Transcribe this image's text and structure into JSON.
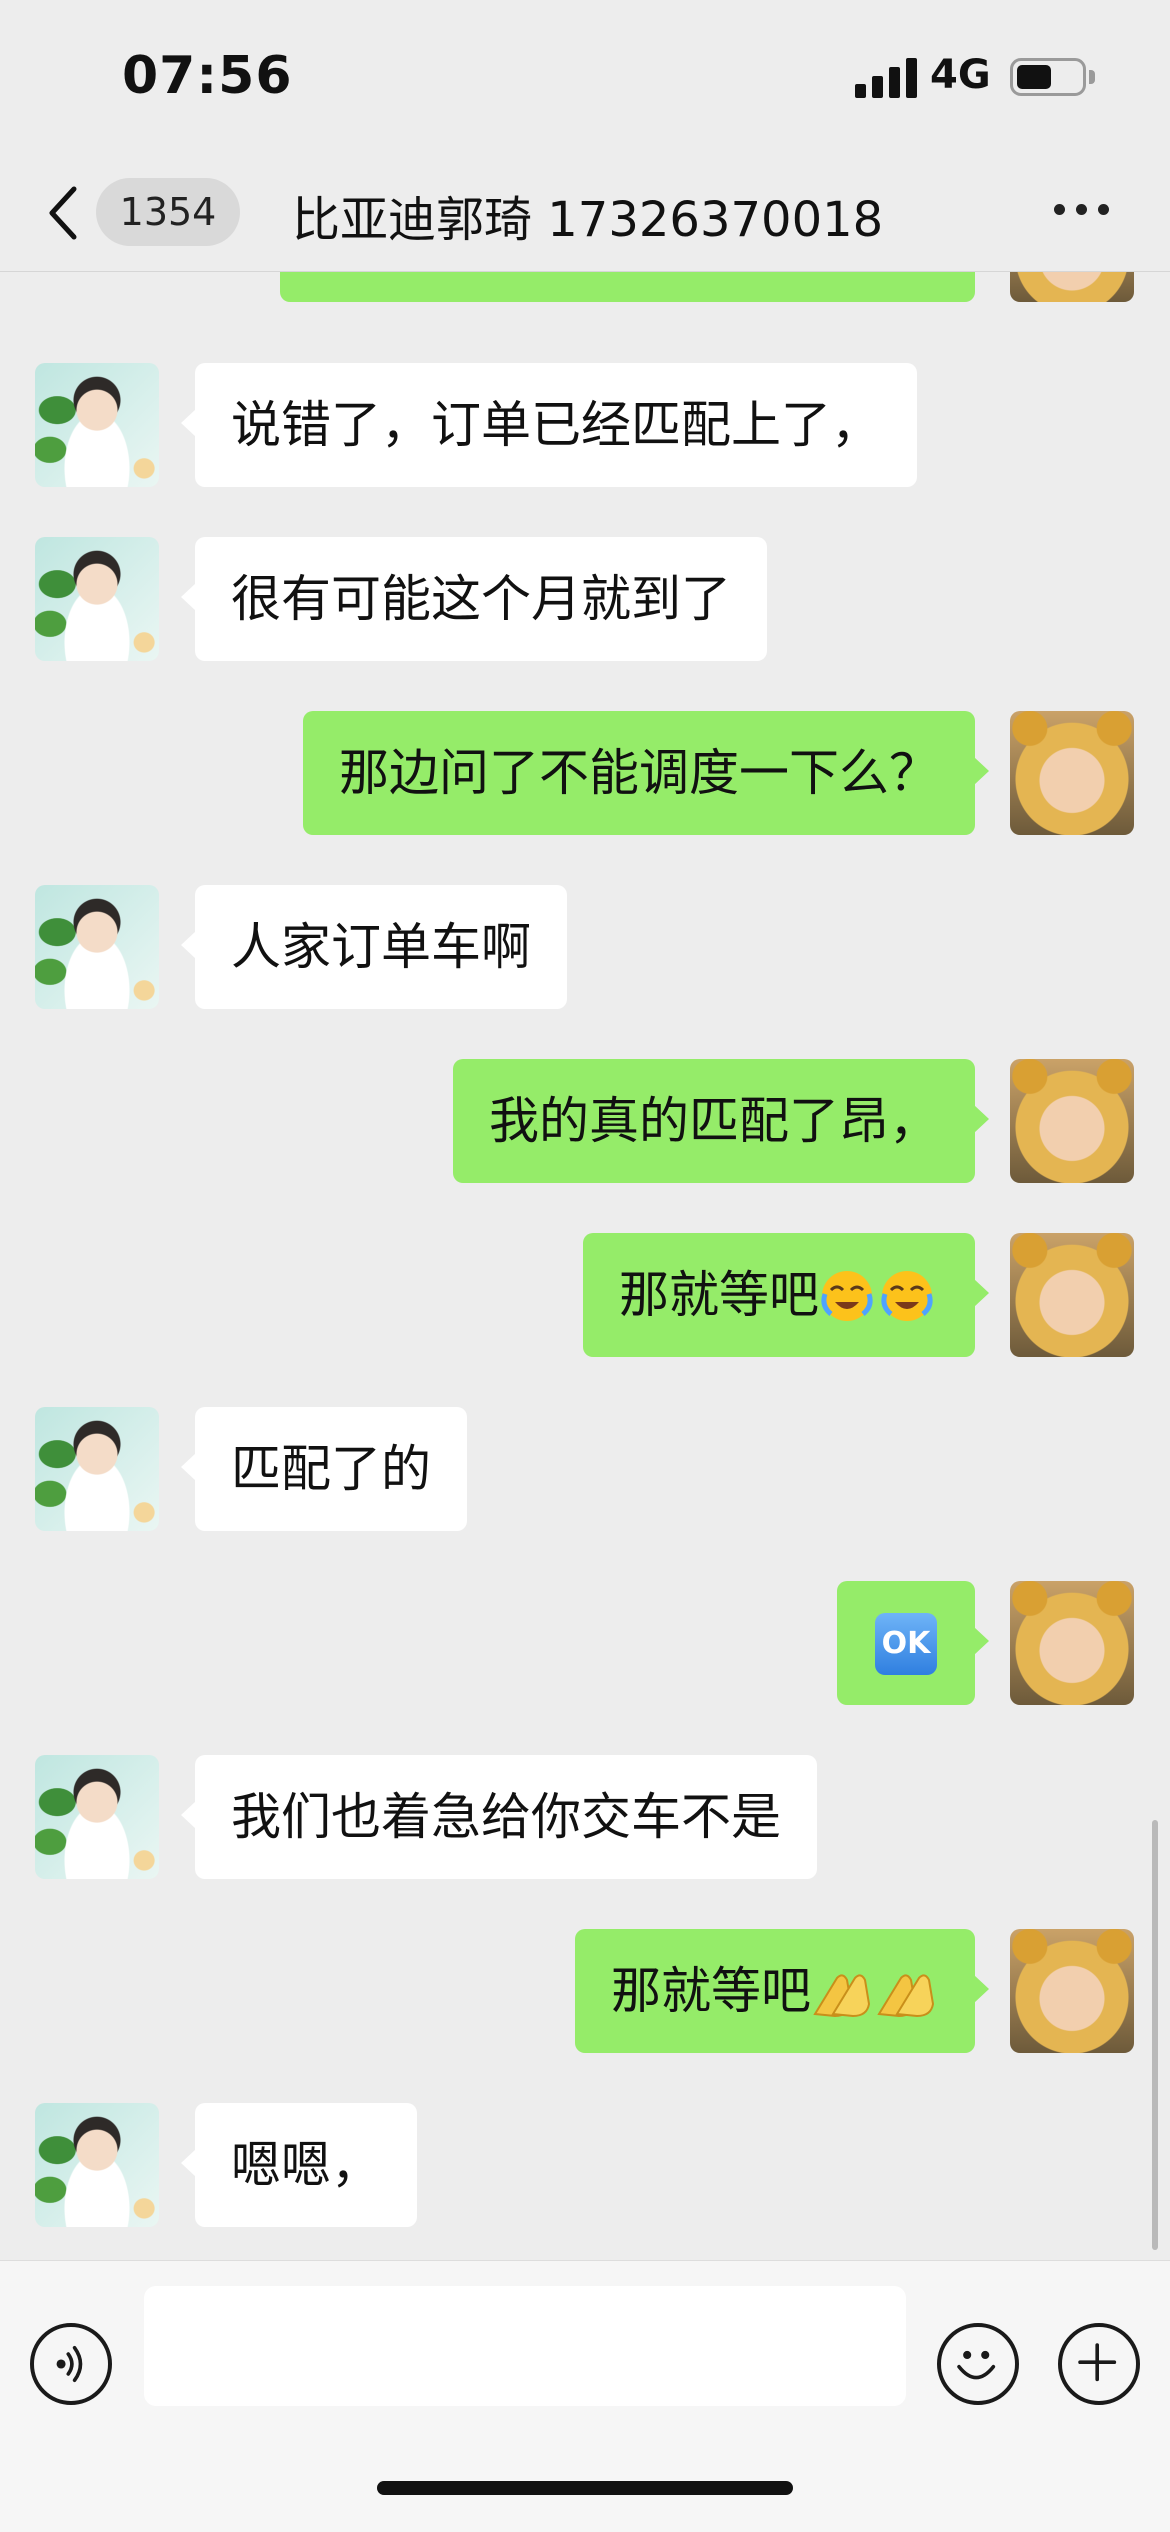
{
  "status_bar": {
    "time": "07:56",
    "network": "4G",
    "battery_level": 0.55
  },
  "nav": {
    "unread_count": "1354",
    "title": "比亚迪郭琦 17326370018"
  },
  "messages": [
    {
      "side": "in",
      "text": "说错了，订单已经匹配上了，"
    },
    {
      "side": "in",
      "text": "很有可能这个月就到了"
    },
    {
      "side": "out",
      "text": "那边问了不能调度一下么？"
    },
    {
      "side": "in",
      "text": "人家订单车啊"
    },
    {
      "side": "out",
      "text": "我的真的匹配了昂，"
    },
    {
      "side": "out",
      "text": "那就等吧",
      "emoji": "loudly-crying-face-emoji ×2"
    },
    {
      "side": "in",
      "text": "匹配了的"
    },
    {
      "side": "out",
      "text": "",
      "emoji": "ok-button-emoji",
      "ok_label": "OK"
    },
    {
      "side": "in",
      "text": "我们也着急给你交车不是"
    },
    {
      "side": "out",
      "text": "那就等吧",
      "emoji": "clapping-hands-emoji ×2"
    },
    {
      "side": "in",
      "text": "嗯嗯，"
    }
  ],
  "input": {
    "value": "",
    "placeholder": ""
  },
  "colors": {
    "outgoing_bubble": "#95ec69",
    "incoming_bubble": "#ffffff",
    "background": "#ededed"
  }
}
